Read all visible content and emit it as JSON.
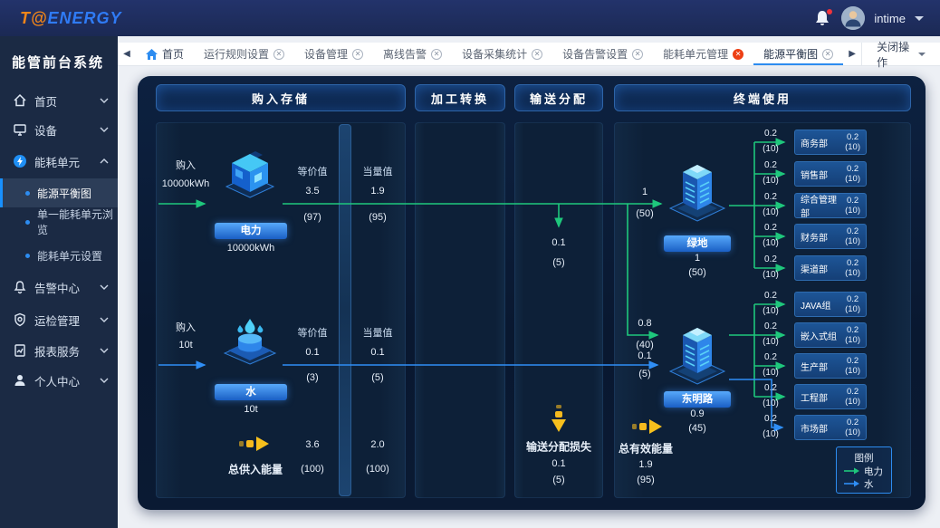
{
  "colors": {
    "accent": "#1890ff",
    "electric_flow": "#1ec77c",
    "water_flow": "#2f8ef5",
    "loss_arrow": "#f5b91e",
    "logo_orange": "#f08519",
    "logo_blue": "#2f7bf5"
  },
  "navbar": {
    "logo_prefix": "T@",
    "logo_suffix": "ENERGY",
    "username": "intime"
  },
  "sidebar": {
    "title": "能管前台系统",
    "items": [
      {
        "label": "首页"
      },
      {
        "label": "设备"
      },
      {
        "label": "能耗单元"
      },
      {
        "label": "告警中心"
      },
      {
        "label": "运检管理"
      },
      {
        "label": "报表服务"
      },
      {
        "label": "个人中心"
      }
    ],
    "subitems": [
      {
        "label": "能源平衡图"
      },
      {
        "label": "单一能耗单元浏览"
      },
      {
        "label": "能耗单元设置"
      }
    ]
  },
  "tabbar": {
    "home": "首页",
    "tabs": [
      {
        "label": "运行规则设置"
      },
      {
        "label": "设备管理"
      },
      {
        "label": "离线告警"
      },
      {
        "label": "设备采集统计"
      },
      {
        "label": "设备告警设置"
      },
      {
        "label": "能耗单元管理"
      },
      {
        "label": "能源平衡图"
      }
    ],
    "close_menu": "关闭操作"
  },
  "board": {
    "headers": [
      "购入存储",
      "加工转换",
      "输送分配",
      "终端使用"
    ],
    "purchase": {
      "electric": {
        "in_label": "购入",
        "in_value": "10000kWh",
        "name": "电力",
        "amount": "10000kWh",
        "equiv_label": "等价值",
        "equiv_value": "3.5",
        "equiv_pct": "(97)",
        "equal_label": "当量值",
        "equal_value": "1.9",
        "equal_pct": "(95)"
      },
      "water": {
        "in_label": "购入",
        "in_value": "10t",
        "name": "水",
        "amount": "10t",
        "equiv_label": "等价值",
        "equiv_value": "0.1",
        "equiv_pct": "(3)",
        "equal_label": "当量值",
        "equal_value": "0.1",
        "equal_pct": "(5)"
      },
      "total": {
        "label": "总供入能量",
        "equiv_value": "3.6",
        "equiv_pct": "(100)",
        "equal_value": "2.0",
        "equal_pct": "(100)"
      }
    },
    "distribution": {
      "branch_value": "0.1",
      "branch_pct": "(5)",
      "loss_label": "输送分配损失",
      "loss_value": "0.1",
      "loss_pct": "(5)"
    },
    "terminal": {
      "building1": {
        "name": "绿地",
        "value": "1",
        "pct": "(50)",
        "in_value": "1",
        "in_pct": "(50)"
      },
      "building2": {
        "name": "东明路",
        "value": "0.9",
        "pct": "(45)",
        "in_green_value": "0.8",
        "in_green_pct": "(40)",
        "in_blue_value": "0.1",
        "in_blue_pct": "(5)"
      },
      "total": {
        "label": "总有效能量",
        "value": "1.9",
        "pct": "(95)"
      },
      "departments": [
        {
          "name": "商务部",
          "flow": "0.2",
          "flow_pct": "(10)",
          "value": "0.2",
          "pct": "(10)"
        },
        {
          "name": "销售部",
          "flow": "0.2",
          "flow_pct": "(10)",
          "value": "0.2",
          "pct": "(10)"
        },
        {
          "name": "综合管理部",
          "flow": "0.2",
          "flow_pct": "(10)",
          "value": "0.2",
          "pct": "(10)"
        },
        {
          "name": "财务部",
          "flow": "0.2",
          "flow_pct": "(10)",
          "value": "0.2",
          "pct": "(10)"
        },
        {
          "name": "渠道部",
          "flow": "0.2",
          "flow_pct": "(10)",
          "value": "0.2",
          "pct": "(10)"
        },
        {
          "name": "JAVA组",
          "flow": "0.2",
          "flow_pct": "(10)",
          "value": "0.2",
          "pct": "(10)"
        },
        {
          "name": "嵌入式组",
          "flow": "0.2",
          "flow_pct": "(10)",
          "value": "0.2",
          "pct": "(10)"
        },
        {
          "name": "生产部",
          "flow": "0.2",
          "flow_pct": "(10)",
          "value": "0.2",
          "pct": "(10)"
        },
        {
          "name": "工程部",
          "flow": "0.2",
          "flow_pct": "(10)",
          "value": "0.2",
          "pct": "(10)"
        },
        {
          "name": "市场部",
          "flow": "0.2",
          "flow_pct": "(10)",
          "value": "0.2",
          "pct": "(10)"
        }
      ],
      "legend": {
        "title": "图例",
        "electric": "电力",
        "water": "水"
      }
    }
  }
}
